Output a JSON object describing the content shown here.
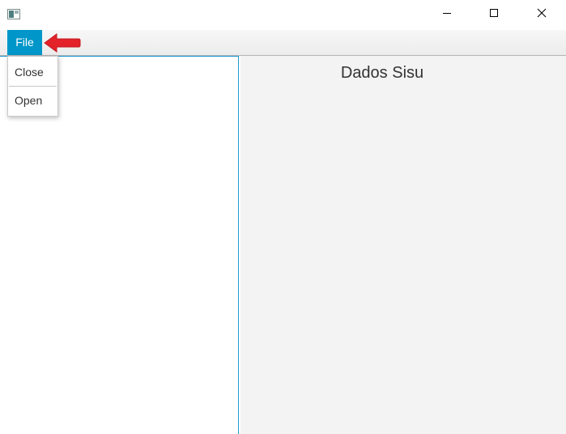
{
  "window": {
    "title": ""
  },
  "menubar": {
    "file_label": "File"
  },
  "file_menu": {
    "items": [
      {
        "label": "Close"
      },
      {
        "label": "Open"
      }
    ]
  },
  "right_pane": {
    "title": "Dados Sisu"
  },
  "colors": {
    "menu_selected": "#0096c9",
    "split_divider": "#1f9bcf",
    "annotation_arrow": "#e3222a"
  },
  "icons": {
    "app": "app-window-icon",
    "minimize": "minimize-icon",
    "maximize": "maximize-icon",
    "close": "close-icon",
    "annotation": "red-arrow-icon"
  }
}
